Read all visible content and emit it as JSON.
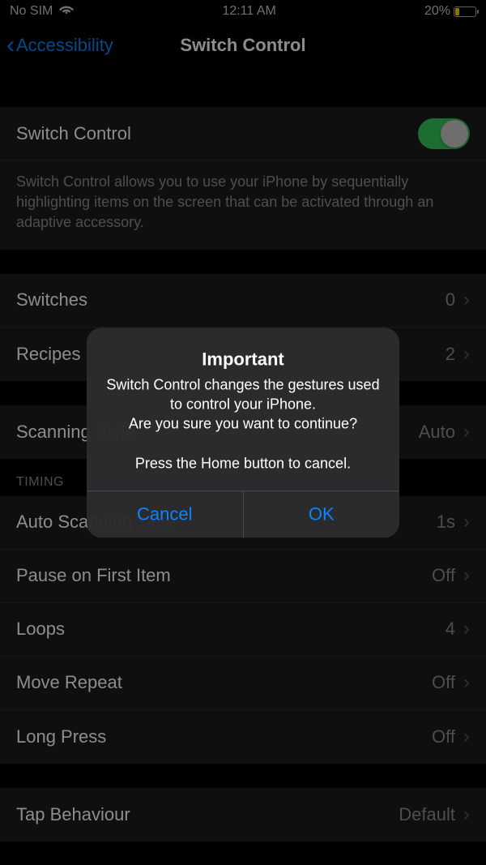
{
  "status": {
    "carrier": "No SIM",
    "time": "12:11 AM",
    "battery_pct": "20%"
  },
  "nav": {
    "back_label": "Accessibility",
    "title": "Switch Control"
  },
  "main_toggle": {
    "label": "Switch Control",
    "footer": "Switch Control allows you to use your iPhone by sequentially highlighting items on the screen that can be activated through an adaptive accessory."
  },
  "group1": {
    "switches": {
      "label": "Switches",
      "value": "0"
    },
    "recipes": {
      "label": "Recipes",
      "value": "2"
    }
  },
  "scanning": {
    "label": "Scanning Style",
    "value": "Auto"
  },
  "timing": {
    "header": "TIMING",
    "auto_scan": {
      "label": "Auto Scanning Time",
      "value": "1s"
    },
    "pause": {
      "label": "Pause on First Item",
      "value": "Off"
    },
    "loops": {
      "label": "Loops",
      "value": "4"
    },
    "move_repeat": {
      "label": "Move Repeat",
      "value": "Off"
    },
    "long_press": {
      "label": "Long Press",
      "value": "Off"
    }
  },
  "tap": {
    "label": "Tap Behaviour",
    "value": "Default"
  },
  "alert": {
    "title": "Important",
    "message": "Switch Control changes the gestures used to control your iPhone.\nAre you sure you want to continue?\n\nPress the Home button to cancel.",
    "cancel": "Cancel",
    "ok": "OK"
  }
}
